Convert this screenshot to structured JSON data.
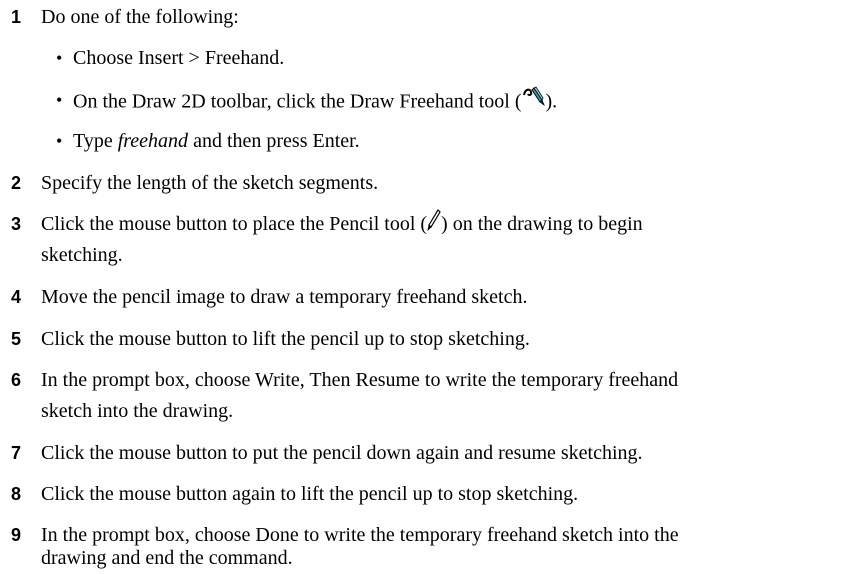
{
  "steps": [
    {
      "num": "1",
      "text": "Do one of the following:"
    },
    {
      "num": "2",
      "text": "Specify the length of the sketch segments."
    },
    {
      "num": "3",
      "text_a": "Click the mouse button to place the Pencil tool (",
      "text_b": ") on the drawing to begin",
      "text_c": "sketching."
    },
    {
      "num": "4",
      "text": "Move the pencil image to draw a temporary freehand sketch."
    },
    {
      "num": "5",
      "text": "Click the mouse button to lift the pencil up to stop sketching."
    },
    {
      "num": "6",
      "text_a": "In the prompt box, choose Write, Then Resume to write the temporary freehand",
      "text_b": "sketch into the drawing."
    },
    {
      "num": "7",
      "text": "Click the mouse button to put the pencil down again and resume sketching."
    },
    {
      "num": "8",
      "text": "Click the mouse button again to lift the pencil up to stop sketching."
    },
    {
      "num": "9",
      "text_a": "In the prompt box, choose Done to write the temporary freehand sketch into the",
      "text_b": "drawing and end the command."
    }
  ],
  "bullets": [
    {
      "marker": "•",
      "text": "Choose Insert > Freehand."
    },
    {
      "marker": "•",
      "text_a": "On the Draw 2D toolbar, click the Draw Freehand tool (",
      "text_b": ")."
    },
    {
      "marker": "•",
      "text_a": "Type ",
      "italic": "freehand",
      "text_b": " and then press Enter."
    }
  ],
  "icons": {
    "freehand_tool": "freehand-tool-icon",
    "pencil_tool": "pencil-icon"
  }
}
